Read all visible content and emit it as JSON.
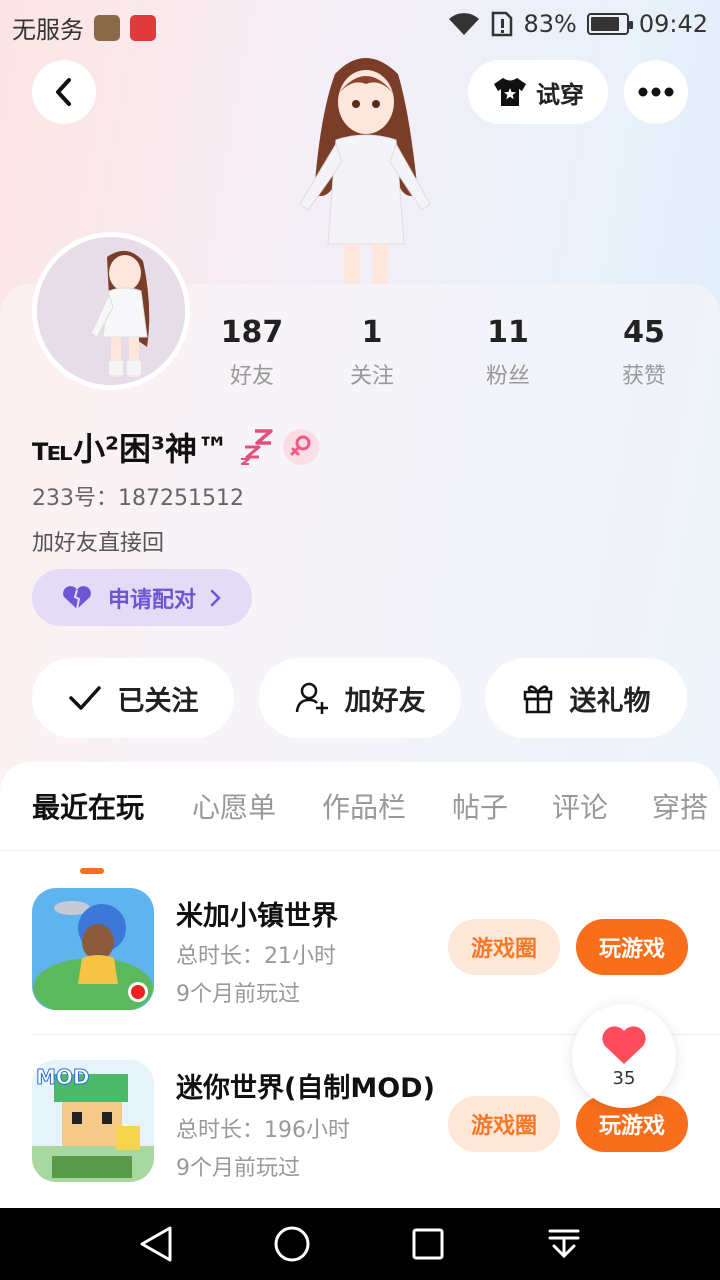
{
  "status_bar": {
    "carrier": "无服务",
    "battery_percent": "83%",
    "battery_level": 0.83,
    "time": "09:42"
  },
  "header": {
    "try_on_label": "试穿"
  },
  "profile": {
    "stats": [
      {
        "value": "187",
        "label": "好友"
      },
      {
        "value": "1",
        "label": "关注"
      },
      {
        "value": "11",
        "label": "粉丝"
      },
      {
        "value": "45",
        "label": "获赞"
      }
    ],
    "username": "℡小²困³神™",
    "uid": "233号：187251512",
    "bio": "加好友直接回",
    "pair_label": "申请配对"
  },
  "actions": {
    "followed_label": "已关注",
    "add_friend_label": "加好友",
    "send_gift_label": "送礼物"
  },
  "tabs": [
    "最近在玩",
    "心愿单",
    "作品栏",
    "帖子",
    "评论",
    "穿搭"
  ],
  "games": [
    {
      "name": "米加小镇世界",
      "duration": "总时长：21小时",
      "last_played": "9个月前玩过",
      "circle_label": "游戏圈",
      "play_label": "玩游戏"
    },
    {
      "name": "迷你世界(自制MOD)",
      "duration": "总时长：196小时",
      "last_played": "9个月前玩过",
      "circle_label": "游戏圈",
      "play_label": "玩游戏",
      "icon_text": "MOD"
    }
  ],
  "like_float": {
    "count": "35"
  },
  "colors": {
    "accent": "#f86e1b",
    "pair_bg": "#e4dcf7",
    "pair_text": "#6d55d4",
    "heart": "#ff4d5e"
  }
}
